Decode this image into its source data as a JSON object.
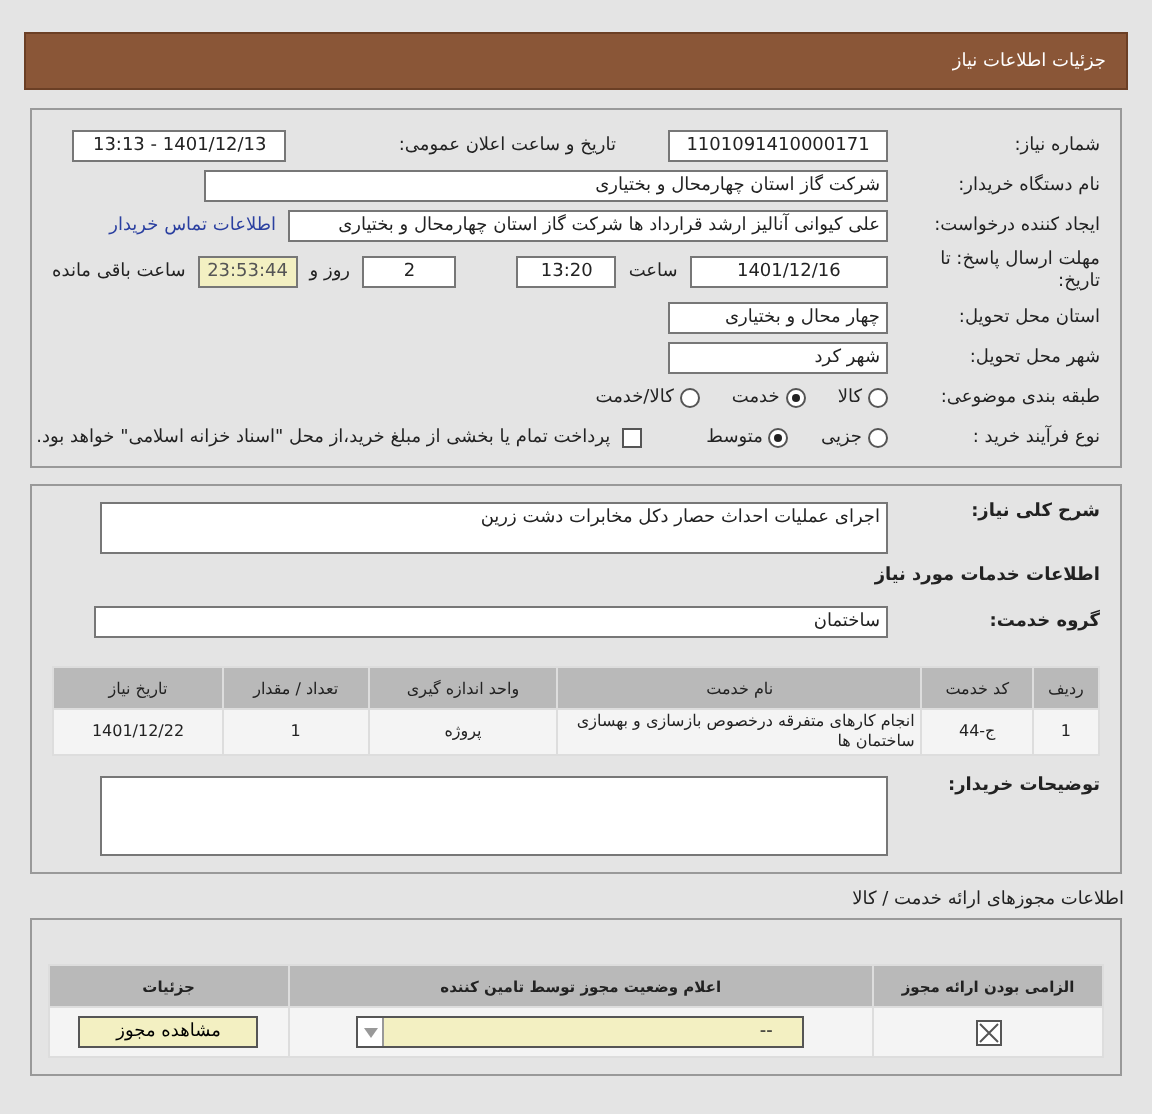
{
  "window": {
    "title": "جزئیات اطلاعات نیاز"
  },
  "need": {
    "number": {
      "label": "شماره نیاز:",
      "value": "1101091410000171"
    },
    "announce": {
      "label": "تاریخ و ساعت اعلان عمومی:",
      "value": "1401/12/13 - 13:13"
    },
    "buyer_org": {
      "label": "نام دستگاه خریدار:",
      "value": "شرکت گاز استان چهارمحال و بختیاری"
    },
    "requester": {
      "label": "ایجاد کننده درخواست:",
      "value": "علی کیوانی آنالیز ارشد قرارداد ها شرکت گاز استان چهارمحال و بختیاری",
      "link": "اطلاعات تماس خریدار"
    },
    "deadline": {
      "label": "مهلت ارسال پاسخ: تا تاریخ:",
      "date": "1401/12/16",
      "time_label": "ساعت",
      "time": "13:20",
      "days": "2",
      "days_label": "روز و",
      "remaining": "23:53:44",
      "remaining_label": "ساعت باقی مانده"
    },
    "province": {
      "label": "استان محل تحویل:",
      "value": "چهار محال و بختیاری"
    },
    "city": {
      "label": "شهر محل تحویل:",
      "value": "شهر کرد"
    },
    "category": {
      "label": "طبقه بندی موضوعی:",
      "options": [
        {
          "label": "کالا",
          "selected": false
        },
        {
          "label": "خدمت",
          "selected": true
        },
        {
          "label": "کالا/خدمت",
          "selected": false
        }
      ]
    },
    "process": {
      "label": "نوع فرآیند خرید :",
      "options": [
        {
          "label": "جزیی",
          "selected": false
        },
        {
          "label": "متوسط",
          "selected": true
        }
      ],
      "payment": {
        "label": "پرداخت تمام یا بخشی از مبلغ خرید،از محل \"اسناد خزانه اسلامی\" خواهد بود.",
        "checked": false
      }
    }
  },
  "services": {
    "description": {
      "label": "شرح کلی نیاز:",
      "value": "اجرای عملیات احداث حصار دکل مخابرات دشت زرین"
    },
    "section_title": "اطلاعات خدمات مورد نیاز",
    "group": {
      "label": "گروه خدمت:",
      "value": "ساختمان"
    },
    "table": {
      "columns": [
        "ردیف",
        "کد خدمت",
        "نام خدمت",
        "واحد اندازه گیری",
        "تعداد / مقدار",
        "تاریخ نیاز"
      ],
      "rows": [
        [
          "1",
          "ج-44",
          "انجام کارهای متفرقه درخصوص بازسازی و بهسازی ساختمان ها",
          "پروژه",
          "1",
          "1401/12/22"
        ]
      ]
    },
    "buyer_notes": {
      "label": "توضیحات خریدار:"
    }
  },
  "permits": {
    "title": "اطلاعات مجوزهای ارائه خدمت / کالا",
    "columns": [
      "الزامی بودن ارائه مجوز",
      "اعلام وضعیت مجوز توسط تامین کننده",
      "جزئیات"
    ],
    "rows": [
      {
        "required": true,
        "status": "--",
        "button": "مشاهده مجوز"
      }
    ]
  }
}
